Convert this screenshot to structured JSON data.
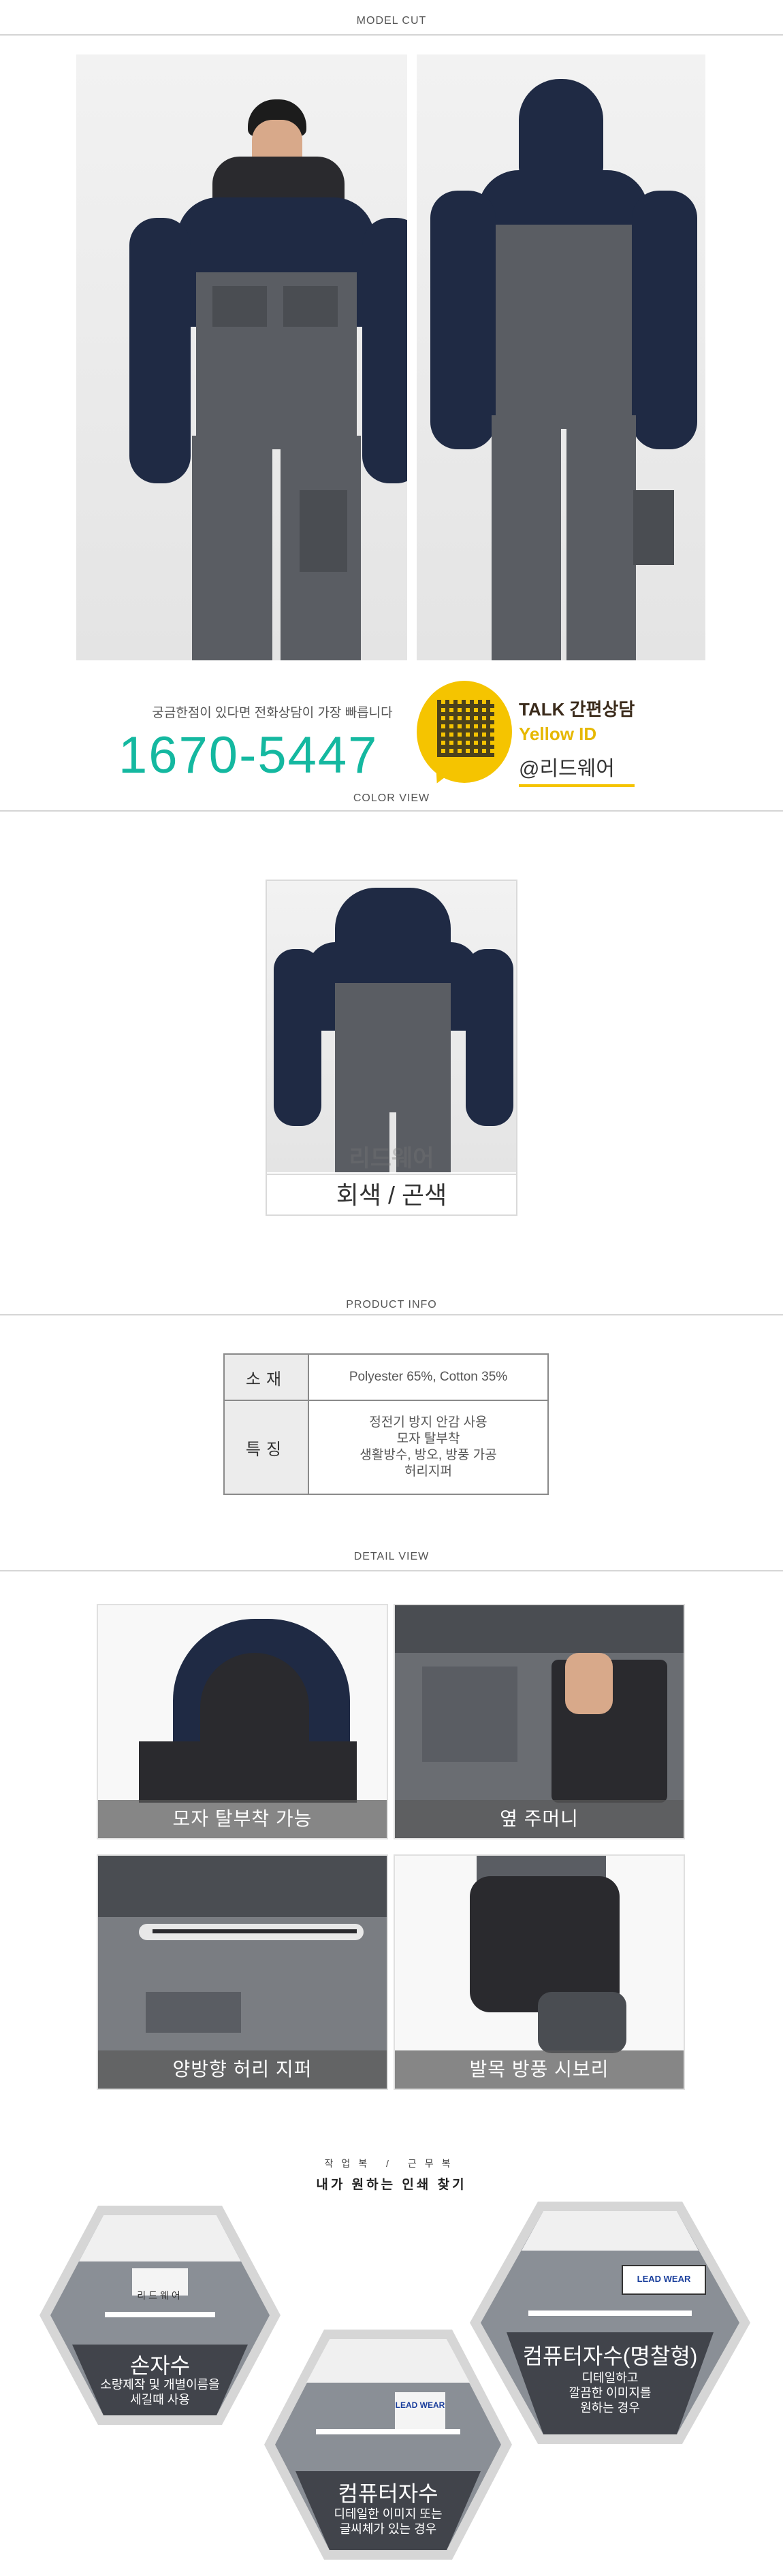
{
  "sections": {
    "model_cut": "MODEL CUT",
    "color_view": "COLOR VIEW",
    "product_info": "PRODUCT INFO",
    "detail_view": "DETAIL VIEW"
  },
  "contact": {
    "note": "궁금한점이 있다면 전화상담이 가장 빠릅니다",
    "phone": "1670-5447"
  },
  "kakao": {
    "line1": "TALK 간편상담",
    "line2": "Yellow ID",
    "line3": "@리드웨어"
  },
  "color_view": {
    "label": "회색 / 곤색",
    "watermark": "리드웨어"
  },
  "product_info": {
    "rows": [
      {
        "key": "소재",
        "lines": [
          "Polyester 65%, Cotton 35%"
        ]
      },
      {
        "key": "특징",
        "lines": [
          "정전기 방지 안감 사용",
          "모자 탈부착",
          "생활방수, 방오, 방풍 가공",
          "허리지퍼"
        ]
      }
    ]
  },
  "details": [
    {
      "caption": "모자 탈부착 가능"
    },
    {
      "caption": "옆 주머니"
    },
    {
      "caption": "양방향 허리 지퍼"
    },
    {
      "caption": "발목 방풍 시보리"
    }
  ],
  "finder": {
    "small": "작업복 / 근무복",
    "big": "내가 원하는 인쇄 찾기",
    "options": [
      {
        "title": "손자수",
        "desc1": "소량제작 및 개별이름을",
        "desc2": "세길때 사용",
        "tag": "리드웨어"
      },
      {
        "title": "컴퓨터자수",
        "desc1": "디테일한 이미지 또는",
        "desc2": "글씨체가 있는 경우",
        "tag": "LEAD WEAR"
      },
      {
        "title": "컴퓨터자수(명찰형)",
        "desc1": "디테일하고",
        "desc2": "깔끔한 이미지를",
        "desc3": "원하는 경우",
        "tag": "LEAD WEAR"
      }
    ]
  }
}
